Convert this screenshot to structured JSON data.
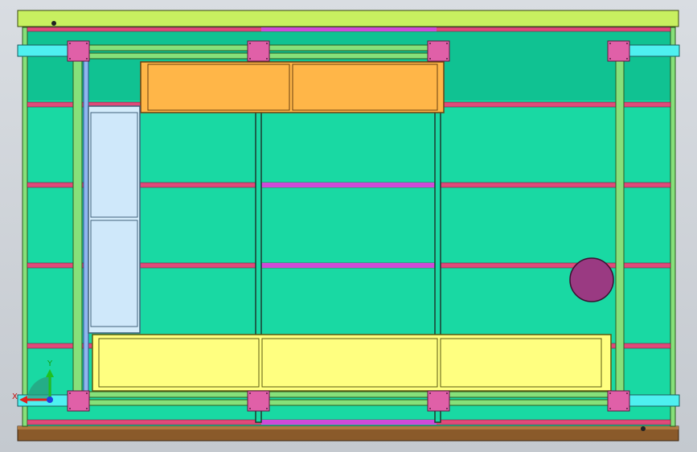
{
  "viewport": {
    "background": "#cfd3d8",
    "colors": {
      "panel_fill": "#19d9a3",
      "panel_top_fill": "#10c292",
      "top_rail": "#c8f060",
      "bottom_rail": "#8a5a2a",
      "magenta_bar": "#e04a7a",
      "purple_bar": "#d04ad8",
      "green_post": "#86e07a",
      "cyan_bracket": "#4ef0f0",
      "pink_connector": "#e060a8",
      "orange_box": "#ffb648",
      "yellow_box": "#ffff80",
      "light_blue_panel": "#d4ecfb",
      "circle_fill": "#9a3a82"
    }
  },
  "triad": {
    "x_label": "X",
    "y_label": "Y"
  }
}
